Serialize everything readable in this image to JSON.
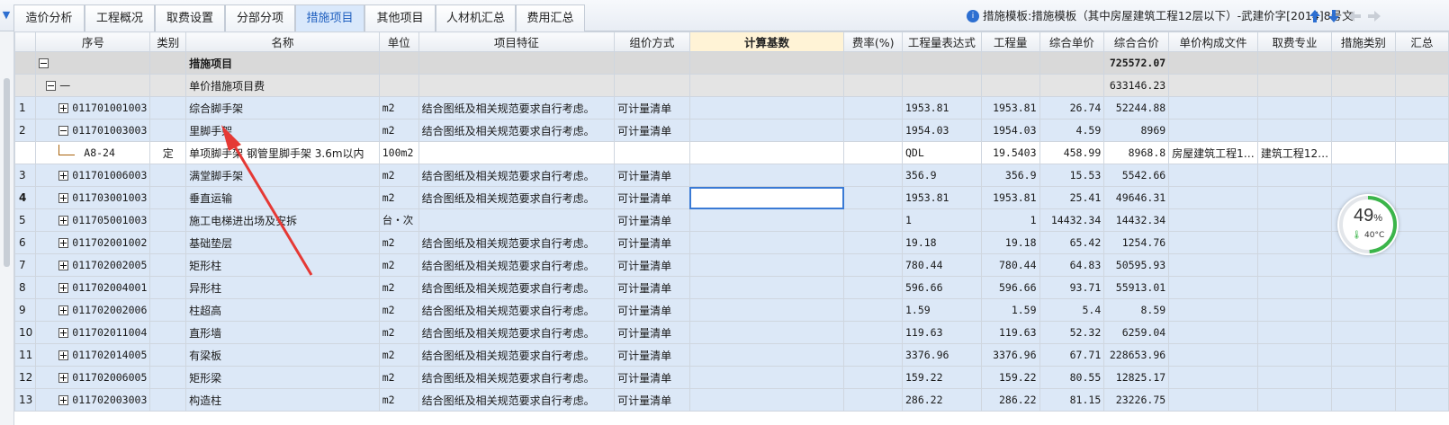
{
  "tabs": [
    {
      "label": "造价分析",
      "active": false
    },
    {
      "label": "工程概况",
      "active": false
    },
    {
      "label": "取费设置",
      "active": false
    },
    {
      "label": "分部分项",
      "active": false
    },
    {
      "label": "措施项目",
      "active": true
    },
    {
      "label": "其他项目",
      "active": false
    },
    {
      "label": "人材机汇总",
      "active": false
    },
    {
      "label": "费用汇总",
      "active": false
    }
  ],
  "template": {
    "text": "措施模板:措施模板（其中房屋建筑工程12层以下）-武建价字[2014]8号文"
  },
  "nav_icons": {
    "up": "arrow-up-icon",
    "down": "arrow-down-icon",
    "left": "arrow-left-icon",
    "right": "arrow-right-icon",
    "up_color": "#2d6fd1",
    "disabled_color": "#c9ced6"
  },
  "columns": [
    "序号",
    "类别",
    "名称",
    "单位",
    "项目特征",
    "组价方式",
    "计算基数",
    "费率(%)",
    "工程量表达式",
    "工程量",
    "综合单价",
    "综合合价",
    "单价构成文件",
    "取费专业",
    "措施类别",
    "汇总"
  ],
  "group": {
    "name": "措施项目",
    "total": "725572.07"
  },
  "subgroup": {
    "code": "—",
    "name": "单价措施项目费",
    "total": "633146.23"
  },
  "rows": [
    {
      "no": "1",
      "code": "011701001003",
      "name": "综合脚手架",
      "unit": "m2",
      "feature": "结合图纸及相关规范要求自行考虑。",
      "method": "可计量清单",
      "expr": "1953.81",
      "qty": "1953.81",
      "price": "26.74",
      "total": "52244.88",
      "expand": "plus"
    },
    {
      "no": "2",
      "code": "011701003003",
      "name": "里脚手架",
      "unit": "m2",
      "feature": "结合图纸及相关规范要求自行考虑。",
      "method": "可计量清单",
      "expr": "1954.03",
      "qty": "1954.03",
      "price": "4.59",
      "total": "8969",
      "expand": "minus"
    },
    {
      "sub": true,
      "code": "A8-24",
      "category": "定",
      "name": "单项脚手架 钢管里脚手架 3.6m以内",
      "unit": "100m2",
      "expr": "QDL",
      "qty": "19.5403",
      "price": "458.99",
      "total": "8968.8",
      "file": "房屋建筑工程1…",
      "spec": "建筑工程12…"
    },
    {
      "no": "3",
      "code": "011701006003",
      "name": "满堂脚手架",
      "unit": "m2",
      "feature": "结合图纸及相关规范要求自行考虑。",
      "method": "可计量清单",
      "expr": "356.9",
      "qty": "356.9",
      "price": "15.53",
      "total": "5542.66",
      "expand": "plus"
    },
    {
      "no": "4",
      "code": "011703001003",
      "name": "垂直运输",
      "unit": "m2",
      "feature": "结合图纸及相关规范要求自行考虑。",
      "method": "可计量清单",
      "expr": "1953.81",
      "qty": "1953.81",
      "price": "25.41",
      "total": "49646.31",
      "expand": "plus",
      "selected": true
    },
    {
      "no": "5",
      "code": "011705001003",
      "name": "施工电梯进出场及安拆",
      "unit": "台・次",
      "feature": "",
      "method": "可计量清单",
      "expr": "1",
      "qty": "1",
      "price": "14432.34",
      "total": "14432.34",
      "expand": "plus"
    },
    {
      "no": "6",
      "code": "011702001002",
      "name": "基础垫层",
      "unit": "m2",
      "feature": "结合图纸及相关规范要求自行考虑。",
      "method": "可计量清单",
      "expr": "19.18",
      "qty": "19.18",
      "price": "65.42",
      "total": "1254.76",
      "expand": "plus"
    },
    {
      "no": "7",
      "code": "011702002005",
      "name": "矩形柱",
      "unit": "m2",
      "feature": "结合图纸及相关规范要求自行考虑。",
      "method": "可计量清单",
      "expr": "780.44",
      "qty": "780.44",
      "price": "64.83",
      "total": "50595.93",
      "expand": "plus"
    },
    {
      "no": "8",
      "code": "011702004001",
      "name": "异形柱",
      "unit": "m2",
      "feature": "结合图纸及相关规范要求自行考虑。",
      "method": "可计量清单",
      "expr": "596.66",
      "qty": "596.66",
      "price": "93.71",
      "total": "55913.01",
      "expand": "plus"
    },
    {
      "no": "9",
      "code": "011702002006",
      "name": "柱超高",
      "unit": "m2",
      "feature": "结合图纸及相关规范要求自行考虑。",
      "method": "可计量清单",
      "expr": "1.59",
      "qty": "1.59",
      "price": "5.4",
      "total": "8.59",
      "expand": "plus"
    },
    {
      "no": "10",
      "code": "011702011004",
      "name": "直形墙",
      "unit": "m2",
      "feature": "结合图纸及相关规范要求自行考虑。",
      "method": "可计量清单",
      "expr": "119.63",
      "qty": "119.63",
      "price": "52.32",
      "total": "6259.04",
      "expand": "plus"
    },
    {
      "no": "11",
      "code": "011702014005",
      "name": "有梁板",
      "unit": "m2",
      "feature": "结合图纸及相关规范要求自行考虑。",
      "method": "可计量清单",
      "expr": "3376.96",
      "qty": "3376.96",
      "price": "67.71",
      "total": "228653.96",
      "expand": "plus"
    },
    {
      "no": "12",
      "code": "011702006005",
      "name": "矩形梁",
      "unit": "m2",
      "feature": "结合图纸及相关规范要求自行考虑。",
      "method": "可计量清单",
      "expr": "159.22",
      "qty": "159.22",
      "price": "80.55",
      "total": "12825.17",
      "expand": "plus"
    },
    {
      "no": "13",
      "code": "011702003003",
      "name": "构造柱",
      "unit": "m2",
      "feature": "结合图纸及相关规范要求自行考虑。",
      "method": "可计量清单",
      "expr": "286.22",
      "qty": "286.22",
      "price": "81.15",
      "total": "23226.75",
      "expand": "plus"
    }
  ],
  "monitor": {
    "percent": "49",
    "percent_unit": "%",
    "percent_value": 0.49,
    "temp": "40°C",
    "ring_color": "#3bb54a"
  },
  "annotation": {
    "color": "#e53935",
    "icon": "red-arrow"
  }
}
